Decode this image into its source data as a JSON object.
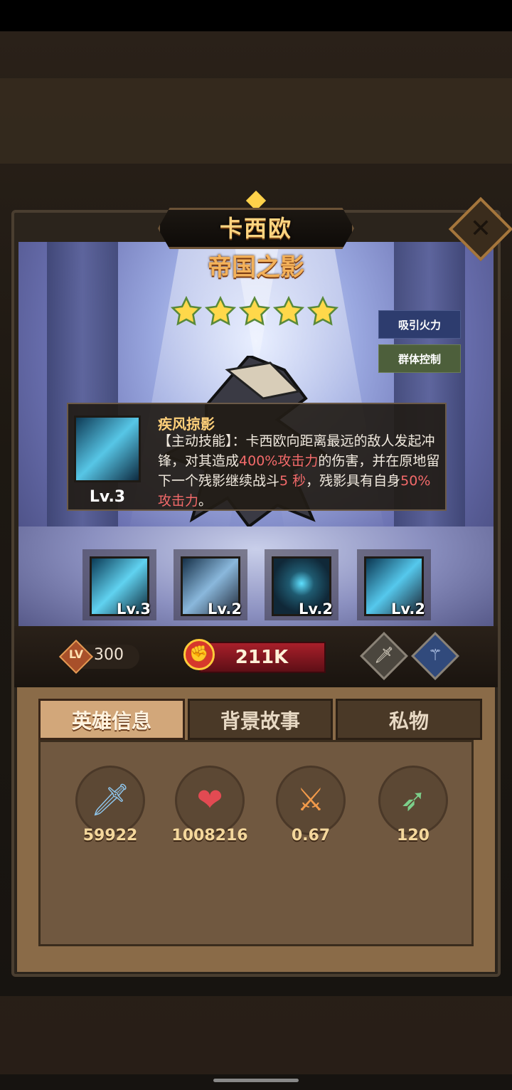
{
  "hero": {
    "name": "卡西欧",
    "title": "帝国之影",
    "stars": 5,
    "tags": [
      "吸引火力",
      "群体控制"
    ]
  },
  "close_icon": "close-icon",
  "skill_tooltip": {
    "name": "疾风掠影",
    "level_label": "Lv.3",
    "desc_parts": [
      {
        "text": "【主动技能】：卡西欧向距离最远的敌人发起冲锋，对其造成",
        "hl": false
      },
      {
        "text": "400%攻击力",
        "hl": true
      },
      {
        "text": "的伤害，并在原地留下一个残影继续战斗",
        "hl": false
      },
      {
        "text": "5 秒",
        "hl": true
      },
      {
        "text": "，残影具有自身",
        "hl": false
      },
      {
        "text": "50%攻击力",
        "hl": true
      },
      {
        "text": "。",
        "hl": false
      }
    ]
  },
  "skills": [
    {
      "level": "Lv.3"
    },
    {
      "level": "Lv.2"
    },
    {
      "level": "Lv.2"
    },
    {
      "level": "Lv.2"
    }
  ],
  "stat_bar": {
    "lv_badge": "LV",
    "level": "300",
    "power": "211K"
  },
  "tabs": [
    "英雄信息",
    "背景故事",
    "私物"
  ],
  "stats": [
    {
      "icon": "sword-icon",
      "value": "59922"
    },
    {
      "icon": "heart-icon",
      "value": "1008216"
    },
    {
      "icon": "attack-speed-icon",
      "value": "0.67"
    },
    {
      "icon": "arrow-range-icon",
      "value": "120"
    }
  ],
  "colors": {
    "title_gold": "#ffd480",
    "highlight_red": "#f36a6a",
    "power_red": "#a81f2a",
    "tab_active": "#d2a77a"
  }
}
